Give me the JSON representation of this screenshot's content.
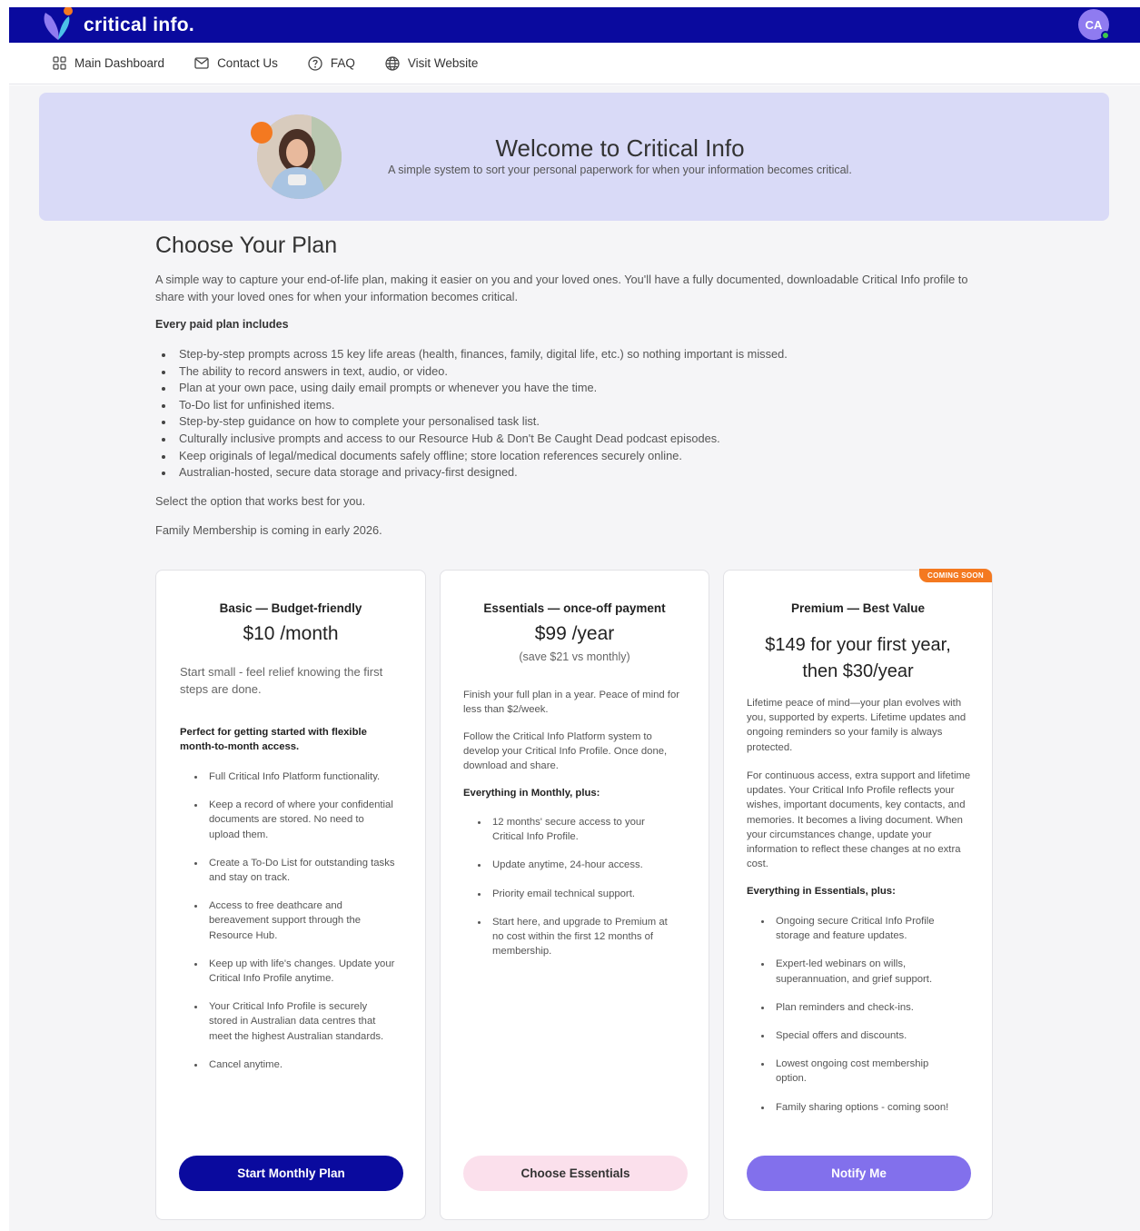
{
  "app": {
    "logo_text": "critical info.",
    "avatar_initials": "CA",
    "colors": {
      "primary": "#0a0a9e",
      "accent_orange": "#f47920",
      "accent_purple": "#8270ec",
      "banner_bg": "#d9daf7",
      "pink": "#fbe0ec"
    }
  },
  "nav": {
    "items": [
      {
        "label": "Main Dashboard",
        "icon": "grid-icon"
      },
      {
        "label": "Contact Us",
        "icon": "mail-icon"
      },
      {
        "label": "FAQ",
        "icon": "help-circle-icon"
      },
      {
        "label": "Visit Website",
        "icon": "globe-icon"
      }
    ]
  },
  "banner": {
    "title": "Welcome to Critical Info",
    "subtitle": "A simple system to sort your personal paperwork for when your information becomes critical."
  },
  "plan": {
    "heading": "Choose Your Plan",
    "intro": "A simple way to capture your end-of-life plan, making it easier on you and your loved ones. You'll have a fully documented, downloadable Critical Info profile to share with your loved ones for when your information becomes critical.",
    "includes_title": "Every paid plan includes",
    "features": [
      "Step-by-step prompts across 15 key life areas (health, finances, family, digital life, etc.) so nothing important is missed.",
      "The ability to record answers in text, audio, or video.",
      "Plan at your own pace, using daily email prompts or whenever you have the time.",
      "To-Do list for unfinished items.",
      "Step-by-step guidance on how to complete your personalised task list.",
      "Culturally inclusive prompts and access to our Resource Hub & Don't Be Caught Dead podcast episodes.",
      "Keep originals of legal/medical documents safely offline; store location references securely online.",
      "Australian-hosted, secure data storage and privacy-first designed."
    ],
    "select_note": "Select the option that works best for you.",
    "family_note": "Family Membership is coming in early 2026."
  },
  "cards": {
    "basic": {
      "title": "Basic — Budget-friendly",
      "price": "$10 /month",
      "tagline": "Start small - feel relief knowing the first steps are done.",
      "perfect_for": "Perfect for getting started with flexible month-to-month access.",
      "items": [
        "Full Critical Info Platform functionality.",
        "Keep a record of where your confidential documents are stored. No need to upload them.",
        "Create a To-Do List for outstanding tasks and stay on track.",
        "Access to free deathcare and bereavement support through the Resource Hub.",
        "Keep up with life's changes. Update your Critical Info Profile anytime.",
        "Your Critical Info Profile is securely stored in Australian data centres that meet the highest Australian standards.",
        "Cancel anytime."
      ],
      "button": "Start Monthly Plan"
    },
    "essentials": {
      "title": "Essentials — once-off payment",
      "price": "$99 /year",
      "save": "(save $21 vs monthly)",
      "para1": "Finish your full plan in a year. Peace of mind for less than $2/week.",
      "para2": "Follow the Critical Info Platform system to develop your Critical Info Profile. Once done, download and share.",
      "plus_label": "Everything in Monthly, plus:",
      "items": [
        "12 months' secure access to your Critical Info Profile.",
        "Update anytime, 24-hour access.",
        "Priority email technical support.",
        "Start here, and upgrade to Premium at no cost within the first 12 months of membership."
      ],
      "button": "Choose Essentials"
    },
    "premium": {
      "badge": "COMING SOON",
      "title": "Premium — Best Value",
      "price_line1": "$149 for your first year,",
      "price_line2": "then $30/year",
      "para1": "Lifetime peace of mind—your plan evolves with you, supported by experts. Lifetime updates and ongoing reminders so your family is always protected.",
      "para2": "For continuous access, extra support and lifetime updates. Your Critical Info Profile reflects your wishes, important documents, key contacts, and memories. It becomes a living document. When your circumstances change, update your information to reflect these changes at no extra cost.",
      "plus_label": "Everything in Essentials, plus:",
      "items": [
        "Ongoing secure Critical Info Profile storage and feature updates.",
        "Expert-led webinars on wills, superannuation, and grief support.",
        "Plan reminders and check-ins.",
        "Special offers and discounts.",
        "Lowest ongoing cost membership option.",
        "Family sharing options - coming soon!"
      ],
      "button": "Notify Me"
    }
  }
}
